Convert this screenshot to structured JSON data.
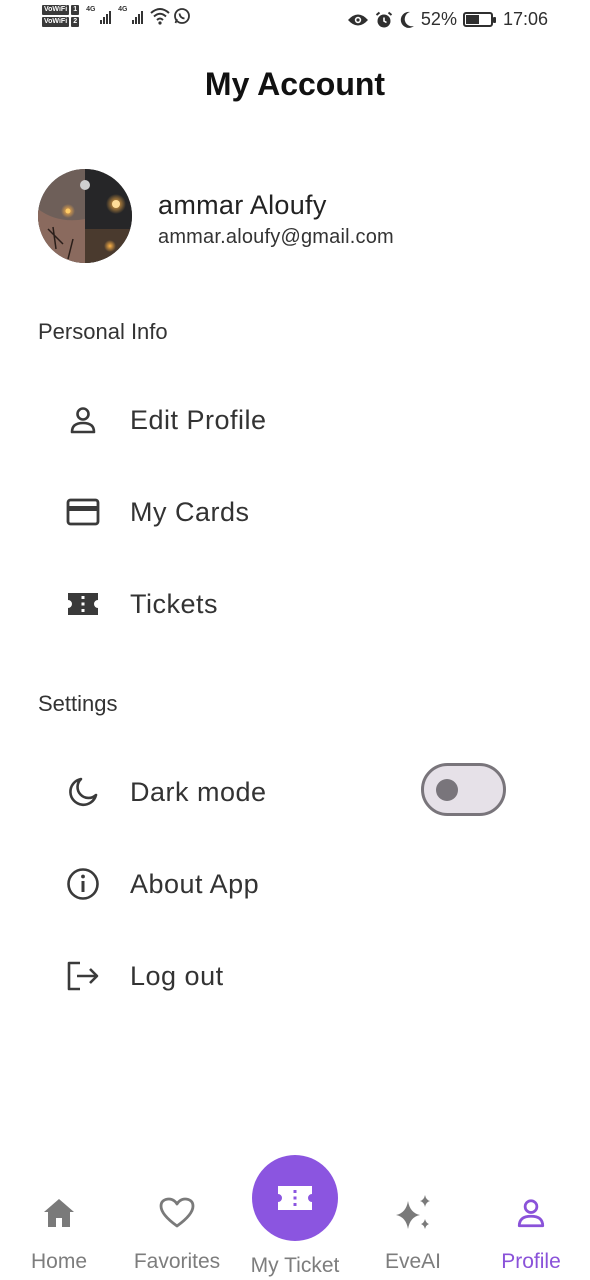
{
  "status_bar": {
    "vowifi_label": "VoWiFi",
    "sim1": "1",
    "sim2": "2",
    "network1": "4G",
    "network2": "4G",
    "battery_percent": "52%",
    "time": "17:06"
  },
  "header": {
    "title": "My Account"
  },
  "profile": {
    "name": "ammar Aloufy",
    "email": "ammar.aloufy@gmail.com"
  },
  "personal_info": {
    "title": "Personal Info",
    "items": [
      {
        "label": "Edit Profile",
        "icon": "person-icon"
      },
      {
        "label": "My Cards",
        "icon": "card-icon"
      },
      {
        "label": "Tickets",
        "icon": "ticket-icon"
      }
    ]
  },
  "settings": {
    "title": "Settings",
    "items": [
      {
        "label": "Dark mode",
        "icon": "moon-icon",
        "toggle_on": false
      },
      {
        "label": "About App",
        "icon": "info-icon"
      },
      {
        "label": "Log out",
        "icon": "logout-icon"
      }
    ]
  },
  "bottom_nav": {
    "active_color": "#8a52d9",
    "fab_color": "#8b55e0",
    "items": [
      {
        "label": "Home",
        "icon": "home-icon"
      },
      {
        "label": "Favorites",
        "icon": "heart-icon"
      },
      {
        "label": "My Ticket",
        "icon": "ticket-icon"
      },
      {
        "label": "EveAI",
        "icon": "sparkle-icon"
      },
      {
        "label": "Profile",
        "icon": "person-icon",
        "active": true
      }
    ]
  }
}
